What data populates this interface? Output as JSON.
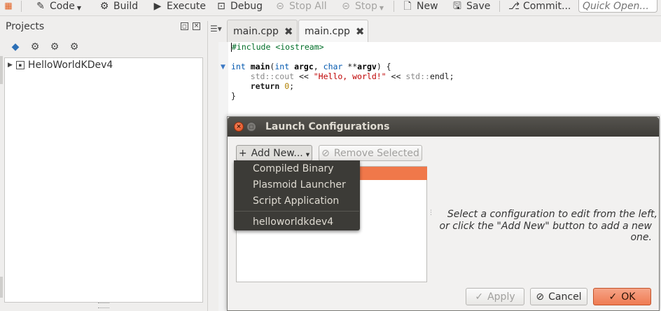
{
  "toolbar": {
    "code_label": "Code",
    "build_label": "Build",
    "execute_label": "Execute",
    "debug_label": "Debug",
    "stop_all_label": "Stop All",
    "stop_label": "Stop",
    "new_label": "New",
    "save_label": "Save",
    "commit_label": "Commit...",
    "quick_open_placeholder": "Quick Open..."
  },
  "projects": {
    "title": "Projects",
    "tree": [
      {
        "label": "HelloWorldKDev4"
      }
    ]
  },
  "editor": {
    "tabs": [
      {
        "label": "main.cpp"
      },
      {
        "label": "main.cpp"
      }
    ],
    "code": {
      "line1_directive": "#include",
      "line1_header": "<iostream>",
      "line3_int": "int",
      "line3_main": "main",
      "line3_type2": "int",
      "line3_argc": "argc",
      "line3_char": "char",
      "line3_argv": "argv",
      "line4_std": "std",
      "line4_cout": "cout",
      "line4_string": "\"Hello, world!\"",
      "line4_std2": "std",
      "line4_endl": "endl",
      "line5_return": "return",
      "line5_zero": "0"
    }
  },
  "dialog": {
    "title": "Launch Configurations",
    "add_new_label": "Add New...",
    "remove_selected_label": "Remove Selected",
    "hint_line1": "Select a configuration to edit from the left,",
    "hint_line2": "or click the \"Add New\" button to add a new one.",
    "apply_label": "Apply",
    "cancel_label": "Cancel",
    "ok_label": "OK"
  },
  "add_new_menu": {
    "items": [
      {
        "label": "Compiled Binary"
      },
      {
        "label": "Plasmoid Launcher"
      },
      {
        "label": "Script Application"
      },
      {
        "label": "helloworldkdev4"
      }
    ]
  },
  "colors": {
    "accent": "#f0784a",
    "title_bar": "#3e3c38",
    "menu_bg": "#3c3b37"
  }
}
